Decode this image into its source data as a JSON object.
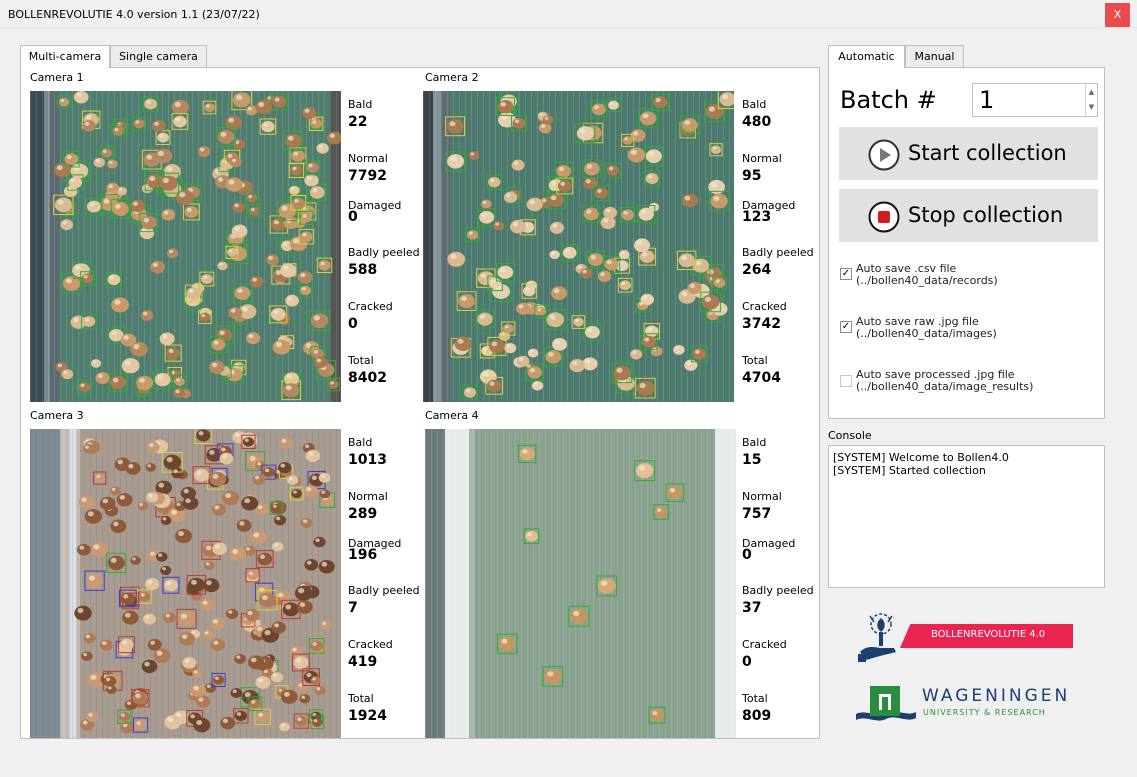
{
  "window": {
    "title": "BOLLENREVOLUTIE 4.0 version 1.1 (23/07/22)",
    "close_label": "X"
  },
  "left_tabs": [
    "Multi-camera",
    "Single camera"
  ],
  "right_tabs": [
    "Automatic",
    "Manual"
  ],
  "cameras": [
    {
      "label": "Camera 1",
      "stats": [
        {
          "label": "Bald",
          "value": "22"
        },
        {
          "label": "Normal",
          "value": "7792"
        },
        {
          "label": "Damaged",
          "value": "0"
        },
        {
          "label": "Badly peeled",
          "value": "588"
        },
        {
          "label": "Cracked",
          "value": "0"
        },
        {
          "label": "Total",
          "value": "8402"
        }
      ]
    },
    {
      "label": "Camera 2",
      "stats": [
        {
          "label": "Bald",
          "value": "480"
        },
        {
          "label": "Normal",
          "value": "95"
        },
        {
          "label": "Damaged",
          "value": "123"
        },
        {
          "label": "Badly peeled",
          "value": "264"
        },
        {
          "label": "Cracked",
          "value": "3742"
        },
        {
          "label": "Total",
          "value": "4704"
        }
      ]
    },
    {
      "label": "Camera 3",
      "stats": [
        {
          "label": "Bald",
          "value": "1013"
        },
        {
          "label": "Normal",
          "value": "289"
        },
        {
          "label": "Damaged",
          "value": "196"
        },
        {
          "label": "Badly peeled",
          "value": "7"
        },
        {
          "label": "Cracked",
          "value": "419"
        },
        {
          "label": "Total",
          "value": "1924"
        }
      ]
    },
    {
      "label": "Camera 4",
      "stats": [
        {
          "label": "Bald",
          "value": "15"
        },
        {
          "label": "Normal",
          "value": "757"
        },
        {
          "label": "Damaged",
          "value": "0"
        },
        {
          "label": "Badly peeled",
          "value": "37"
        },
        {
          "label": "Cracked",
          "value": "0"
        },
        {
          "label": "Total",
          "value": "809"
        }
      ]
    }
  ],
  "automatic": {
    "batch_label": "Batch #",
    "batch_value": "1",
    "start_label": "Start collection",
    "stop_label": "Stop collection",
    "options": [
      {
        "line1": "Auto save .csv file",
        "line2": "(../bollen40_data/records)",
        "checked": true
      },
      {
        "line1": "Auto save raw .jpg file",
        "line2": "(../bollen40_data/images)",
        "checked": true
      },
      {
        "line1": "Auto save processed .jpg file",
        "line2": "(../bollen40_data/image_results)",
        "checked": false
      }
    ]
  },
  "console": {
    "label": "Console",
    "lines": [
      "[SYSTEM] Welcome to Bollen4.0",
      "[SYSTEM] Started collection"
    ]
  },
  "logos": {
    "bollen_text": "BOLLENREVOLUTIE 4.0",
    "wur_name": "WAGENINGEN",
    "wur_sub": "UNIVERSITY & RESEARCH"
  },
  "colors": {
    "accent_red": "#e8244f",
    "wur_green": "#2a8c3f",
    "wur_blue": "#1c3f72",
    "close_red": "#e84c4c",
    "box_green": "#2fae2f",
    "box_yellow": "#d6d23a",
    "box_red": "#c0392b",
    "box_blue": "#3a3ad0"
  }
}
